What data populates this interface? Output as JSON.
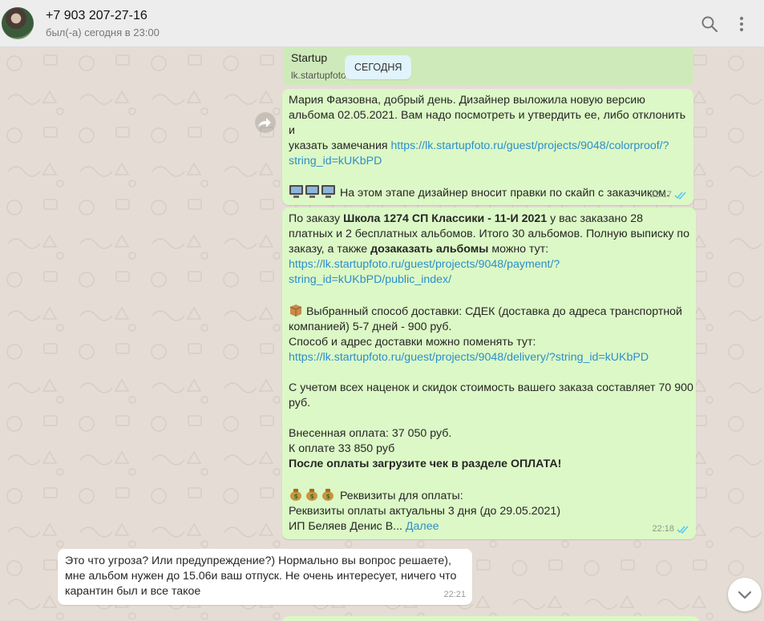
{
  "header": {
    "contact_name": "+7 903 207-27-16",
    "status": "был(-а) сегодня в 23:00"
  },
  "preview": {
    "title": "Startup",
    "url": "lk.startupfoto"
  },
  "date_chip": "СЕГОДНЯ",
  "msg1": {
    "line1": "Мария  Фаязовна, добрый день. Дизайнер выложила новую версию",
    "line2": "альбома 02.05.2021. Вам надо посмотреть и утвердить ее, либо отклонить и",
    "line3": "указать замечания ",
    "link_a": "https://lk.startupfoto.ru/guest/projects/9048/colorproof/?",
    "link_b": "string_id=kUKbPD",
    "line5": "На этом этапе дизайнер вносит правки по скайп с заказчиком.",
    "time": "22:17"
  },
  "msg2": {
    "p1_a": "По заказу ",
    "p1_bold": "Школа  1274 СП Классики - 11-И 2021",
    "p1_b": " у вас заказано 28",
    "p2": "платных и 2 бесплатных альбомов. Итого 30 альбомов. Полную выписку по",
    "p3_a": "заказу, а также ",
    "p3_bold": "дозаказать альбомы",
    "p3_b": " можно тут:",
    "link1_a": "https://lk.startupfoto.ru/guest/projects/9048/payment/?",
    "link1_b": "string_id=kUKbPD/public_index/",
    "d1": " Выбранный способ доставки: СДЕК (доставка до адреса транспортной",
    "d2": "компанией) 5-7 дней - 900 руб.",
    "d3": "Способ и адрес доставки можно поменять тут:",
    "link2": "https://lk.startupfoto.ru/guest/projects/9048/delivery/?string_id=kUKbPD",
    "c1": "С учетом всех наценок и скидок стоимость вашего заказа составляет 70 900",
    "c2": "руб.",
    "pay1": "Внесенная оплата: 37 050 руб.",
    "pay2": "К оплате 33 850 руб",
    "pay3": "После оплаты загрузите чек в разделе ОПЛАТА!",
    "r1": " Реквизиты для оплаты:",
    "r2": "Реквизиты оплаты актуальны 3 дня (до 29.05.2021)",
    "r3": "ИП Беляев Денис В... ",
    "more": "Далее",
    "time": "22:18"
  },
  "msg3": {
    "l1": "Это что угроза? Или предупреждение?) Нормально вы вопрос решаете),",
    "l2": "мне альбом нужен до 15.06и ваш отпуск. Не очень интересует, ничего что",
    "l3": "карантин был и все такое",
    "time": "22:21"
  },
  "colors": {
    "outgoing": "#dcf8c6",
    "incoming": "#ffffff",
    "link": "#2c8fca",
    "read_ticks": "#4fc3f7"
  }
}
